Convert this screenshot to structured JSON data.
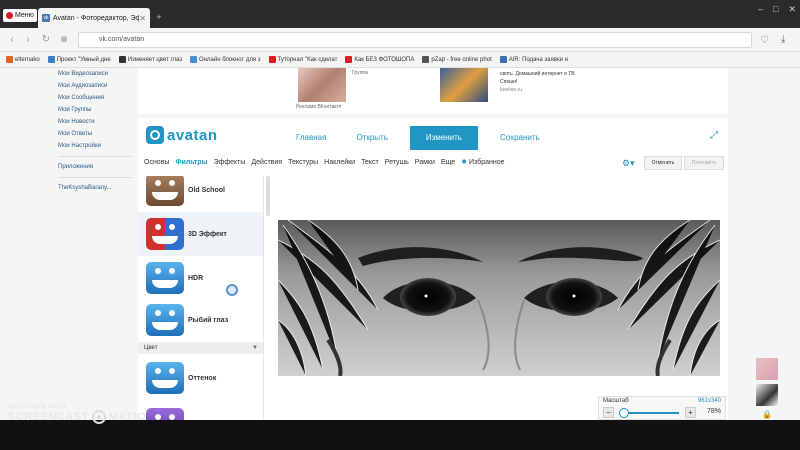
{
  "browser": {
    "menu_label": "Меню",
    "tab_title": "Avatan - Фоторедактор, Эф",
    "url": "vk.com/avatan",
    "bookmarks": [
      {
        "label": "elternako",
        "color": "#e8601c"
      },
      {
        "label": "Проект \"Умный дне",
        "color": "#3a7ec8"
      },
      {
        "label": "Изменяет цвет глаз",
        "color": "#333333"
      },
      {
        "label": "Онлайн блокнот для з",
        "color": "#4a90d9"
      },
      {
        "label": "Туторнал \"Как сделат",
        "color": "#d82020"
      },
      {
        "label": "Как БЕЗ ФОТОШОПА",
        "color": "#d82020"
      },
      {
        "label": "pZap - free online phot",
        "color": "#555555"
      },
      {
        "label": "AIR: Подача заявки н",
        "color": "#3a6fb0"
      }
    ]
  },
  "vk_menu": {
    "items": [
      "Мои Видеозаписи",
      "Мои Аудиозаписи",
      "Мои Сообщения",
      "Мои Группы",
      "Мои Новости",
      "Мои Ответы",
      "Мои Настройки"
    ],
    "apps": "Приложения",
    "profile": "TheKsyshaBarany..."
  },
  "ads": {
    "caption1": "Реклама ВКонтакте",
    "group": "Группа",
    "text2": "свять. Домашний интернет и ТВ. Спеши!",
    "source2": "beeline.ru"
  },
  "editor": {
    "logo": "avatan",
    "nav": {
      "home": "Главная",
      "open": "Открыть",
      "edit": "Изменить",
      "save": "Сохранить"
    },
    "tools": [
      "Основы",
      "Фильтры",
      "Эффекты",
      "Действия",
      "Текстуры",
      "Наклейки",
      "Текст",
      "Ретушь",
      "Рамки",
      "Еще"
    ],
    "favorites": "Избранное",
    "cancel": "Отменить",
    "apply": "Повторить",
    "filters": [
      "Old School",
      "3D Эффект",
      "HDR",
      "Рыбий глаз"
    ],
    "section_color": "Цвет",
    "filters2": [
      "Оттенок"
    ],
    "zoom": {
      "label": "Масштаб",
      "dims": "961x340",
      "percent": "78%",
      "level": 0.78
    }
  },
  "watermark": {
    "top": "RECORDED WITH",
    "brand_left": "SCREENCAST",
    "brand_right": "MATIC"
  }
}
